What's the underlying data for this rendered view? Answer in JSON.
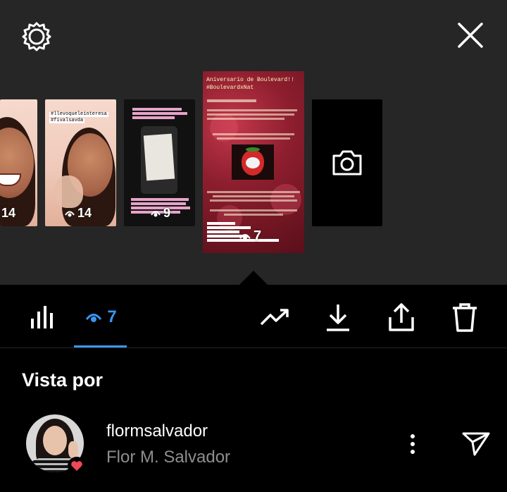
{
  "stories": [
    {
      "id": "s1",
      "count": "14"
    },
    {
      "id": "s2",
      "count": "14",
      "sticker1": "#llevoqueleinteresa",
      "sticker2": "#fivalsavda"
    },
    {
      "id": "s3",
      "count": "9"
    },
    {
      "id": "s4",
      "count": "7",
      "title": "Aniversario de Boulevard!!",
      "hashtag": "#BoulevardxNat"
    }
  ],
  "toolbar": {
    "viewers_count": "7"
  },
  "viewers_section": {
    "title": "Vista por"
  },
  "viewers": [
    {
      "username": "flormsalvador",
      "full_name": "Flor M. Salvador"
    }
  ],
  "colors": {
    "top_bg": "#262626",
    "accent": "#3897f0",
    "muted": "#8e8e8e",
    "heart": "#ed4956"
  }
}
